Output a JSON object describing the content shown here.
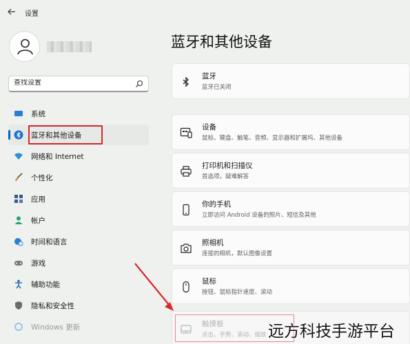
{
  "window": {
    "title": "设置"
  },
  "search": {
    "placeholder": "查找设置"
  },
  "sidebar": {
    "items": [
      {
        "label": "系统",
        "icon": "system-display-icon"
      },
      {
        "label": "蓝牙和其他设备",
        "icon": "bluetooth-icon",
        "active": true
      },
      {
        "label": "网络和 Internet",
        "icon": "wifi-icon"
      },
      {
        "label": "个性化",
        "icon": "brush-icon"
      },
      {
        "label": "应用",
        "icon": "apps-icon"
      },
      {
        "label": "帐户",
        "icon": "account-icon"
      },
      {
        "label": "时间和语言",
        "icon": "globe-clock-icon"
      },
      {
        "label": "游戏",
        "icon": "gamepad-icon"
      },
      {
        "label": "辅助功能",
        "icon": "accessibility-icon"
      },
      {
        "label": "隐私和安全性",
        "icon": "shield-icon"
      },
      {
        "label": "Windows 更新",
        "icon": "update-icon"
      }
    ]
  },
  "main": {
    "title": "蓝牙和其他设备",
    "cards": [
      {
        "title": "蓝牙",
        "desc": "蓝牙已关闭",
        "icon": "bluetooth-icon"
      },
      {
        "title": "设备",
        "desc": "鼠标、键盘、触笔、音频、显示器和扩展坞、其他设备",
        "icon": "devices-icon"
      },
      {
        "title": "打印机和扫描仪",
        "desc": "首选项，疑难解答",
        "icon": "printer-icon"
      },
      {
        "title": "你的手机",
        "desc": "立即访问 Android 设备的照片、短信及其他",
        "icon": "phone-icon"
      },
      {
        "title": "照相机",
        "desc": "连接的相机，默认图像设置",
        "icon": "camera-icon"
      },
      {
        "title": "鼠标",
        "desc": "按钮、鼠标指针速度、滚动",
        "icon": "mouse-icon"
      },
      {
        "title": "触摸板",
        "desc": "点击、手势、滚动、缩放",
        "icon": "touchpad-icon"
      }
    ]
  },
  "watermark": "远方科技手游平台",
  "colors": {
    "accent": "#0067c0",
    "highlight": "#d9272e",
    "background": "#eef1ee"
  }
}
